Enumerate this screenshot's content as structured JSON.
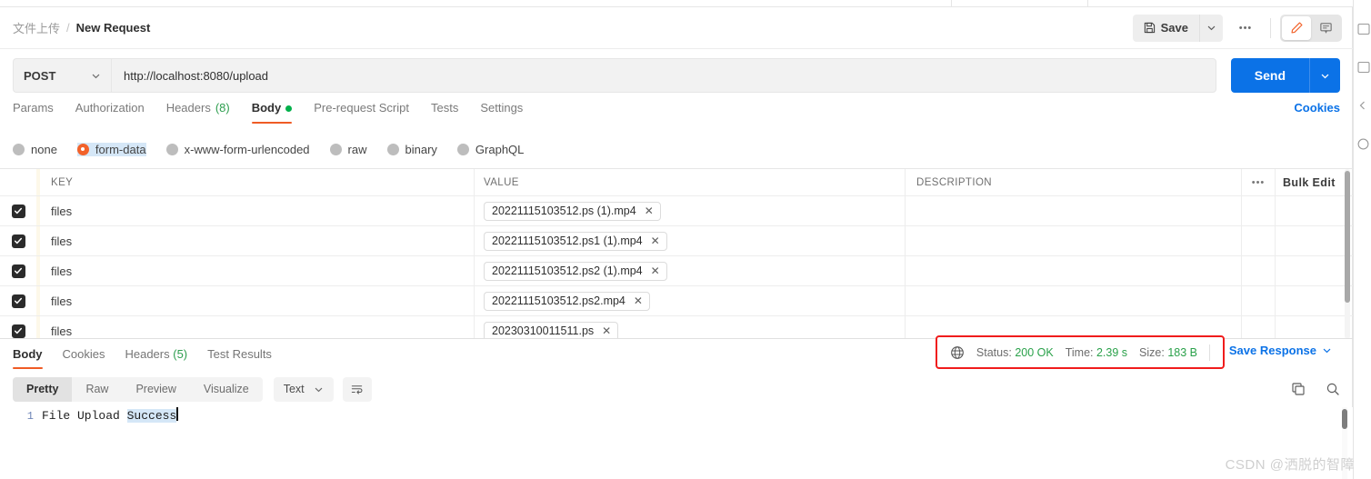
{
  "breadcrumb": {
    "collection": "文件上传",
    "separator": "/",
    "current": "New Request"
  },
  "header_actions": {
    "save_label": "Save",
    "save_caret": "⌄",
    "more_label": "•••",
    "edit_icon": "pencil-icon",
    "comment_icon": "comment-icon"
  },
  "request": {
    "method": "POST",
    "method_caret": "⌄",
    "url": "http://localhost:8080/upload",
    "send_label": "Send",
    "send_caret": "⌄"
  },
  "request_tabs": [
    {
      "label": "Params",
      "count": "",
      "active": false,
      "dot": false
    },
    {
      "label": "Authorization",
      "count": "",
      "active": false,
      "dot": false
    },
    {
      "label": "Headers",
      "count": "(8)",
      "active": false,
      "dot": false
    },
    {
      "label": "Body",
      "count": "",
      "active": true,
      "dot": true
    },
    {
      "label": "Pre-request Script",
      "count": "",
      "active": false,
      "dot": false
    },
    {
      "label": "Tests",
      "count": "",
      "active": false,
      "dot": false
    },
    {
      "label": "Settings",
      "count": "",
      "active": false,
      "dot": false
    }
  ],
  "cookies_link": "Cookies",
  "body_types": [
    {
      "label": "none",
      "selected": false
    },
    {
      "label": "form-data",
      "selected": true
    },
    {
      "label": "x-www-form-urlencoded",
      "selected": false
    },
    {
      "label": "raw",
      "selected": false
    },
    {
      "label": "binary",
      "selected": false
    },
    {
      "label": "GraphQL",
      "selected": false
    }
  ],
  "table": {
    "headers": {
      "key": "KEY",
      "value": "VALUE",
      "description": "DESCRIPTION",
      "more": "•••",
      "bulk_edit": "Bulk Edit"
    },
    "rows": [
      {
        "checked": true,
        "key": "files",
        "value": "20221115103512.ps (1).mp4",
        "remove": "✕",
        "description": ""
      },
      {
        "checked": true,
        "key": "files",
        "value": "20221115103512.ps1 (1).mp4",
        "remove": "✕",
        "description": ""
      },
      {
        "checked": true,
        "key": "files",
        "value": "20221115103512.ps2 (1).mp4",
        "remove": "✕",
        "description": ""
      },
      {
        "checked": true,
        "key": "files",
        "value": "20221115103512.ps2.mp4",
        "remove": "✕",
        "description": ""
      },
      {
        "checked": true,
        "key": "files",
        "value": "20230310011511.ps",
        "remove": "✕",
        "description": ""
      }
    ]
  },
  "response_tabs": [
    {
      "label": "Body",
      "count": "",
      "active": true
    },
    {
      "label": "Cookies",
      "count": "",
      "active": false
    },
    {
      "label": "Headers",
      "count": "(5)",
      "active": false
    },
    {
      "label": "Test Results",
      "count": "",
      "active": false
    }
  ],
  "status": {
    "globe_icon": "globe-icon",
    "status_label": "Status:",
    "status_value": "200 OK",
    "time_label": "Time:",
    "time_value": "2.39 s",
    "size_label": "Size:",
    "size_value": "183 B",
    "highlight_color": "#f01c1c",
    "value_color": "#2aa14a"
  },
  "save_response": {
    "label": "Save Response",
    "caret": "⌄"
  },
  "response_toolbar": {
    "views": [
      {
        "label": "Pretty",
        "active": true
      },
      {
        "label": "Raw",
        "active": false
      },
      {
        "label": "Preview",
        "active": false
      },
      {
        "label": "Visualize",
        "active": false
      }
    ],
    "format": "Text",
    "format_caret": "⌄",
    "wrap_icon": "wrap-lines-icon",
    "copy_icon": "copy-icon",
    "search_icon": "search-icon"
  },
  "response_body": {
    "line_number": "1",
    "text_plain": "File Upload ",
    "text_selected": "Success"
  },
  "right_rail_icons": [
    "layout-sidebar-icon",
    "code-snippet-icon",
    "chevron-icon",
    "info-circle-icon"
  ],
  "watermark": "CSDN @洒脱的智障",
  "accent_colors": {
    "orange": "#ef5b25",
    "blue": "#0b72e7",
    "green": "#2aa14a",
    "red": "#f01c1c"
  }
}
